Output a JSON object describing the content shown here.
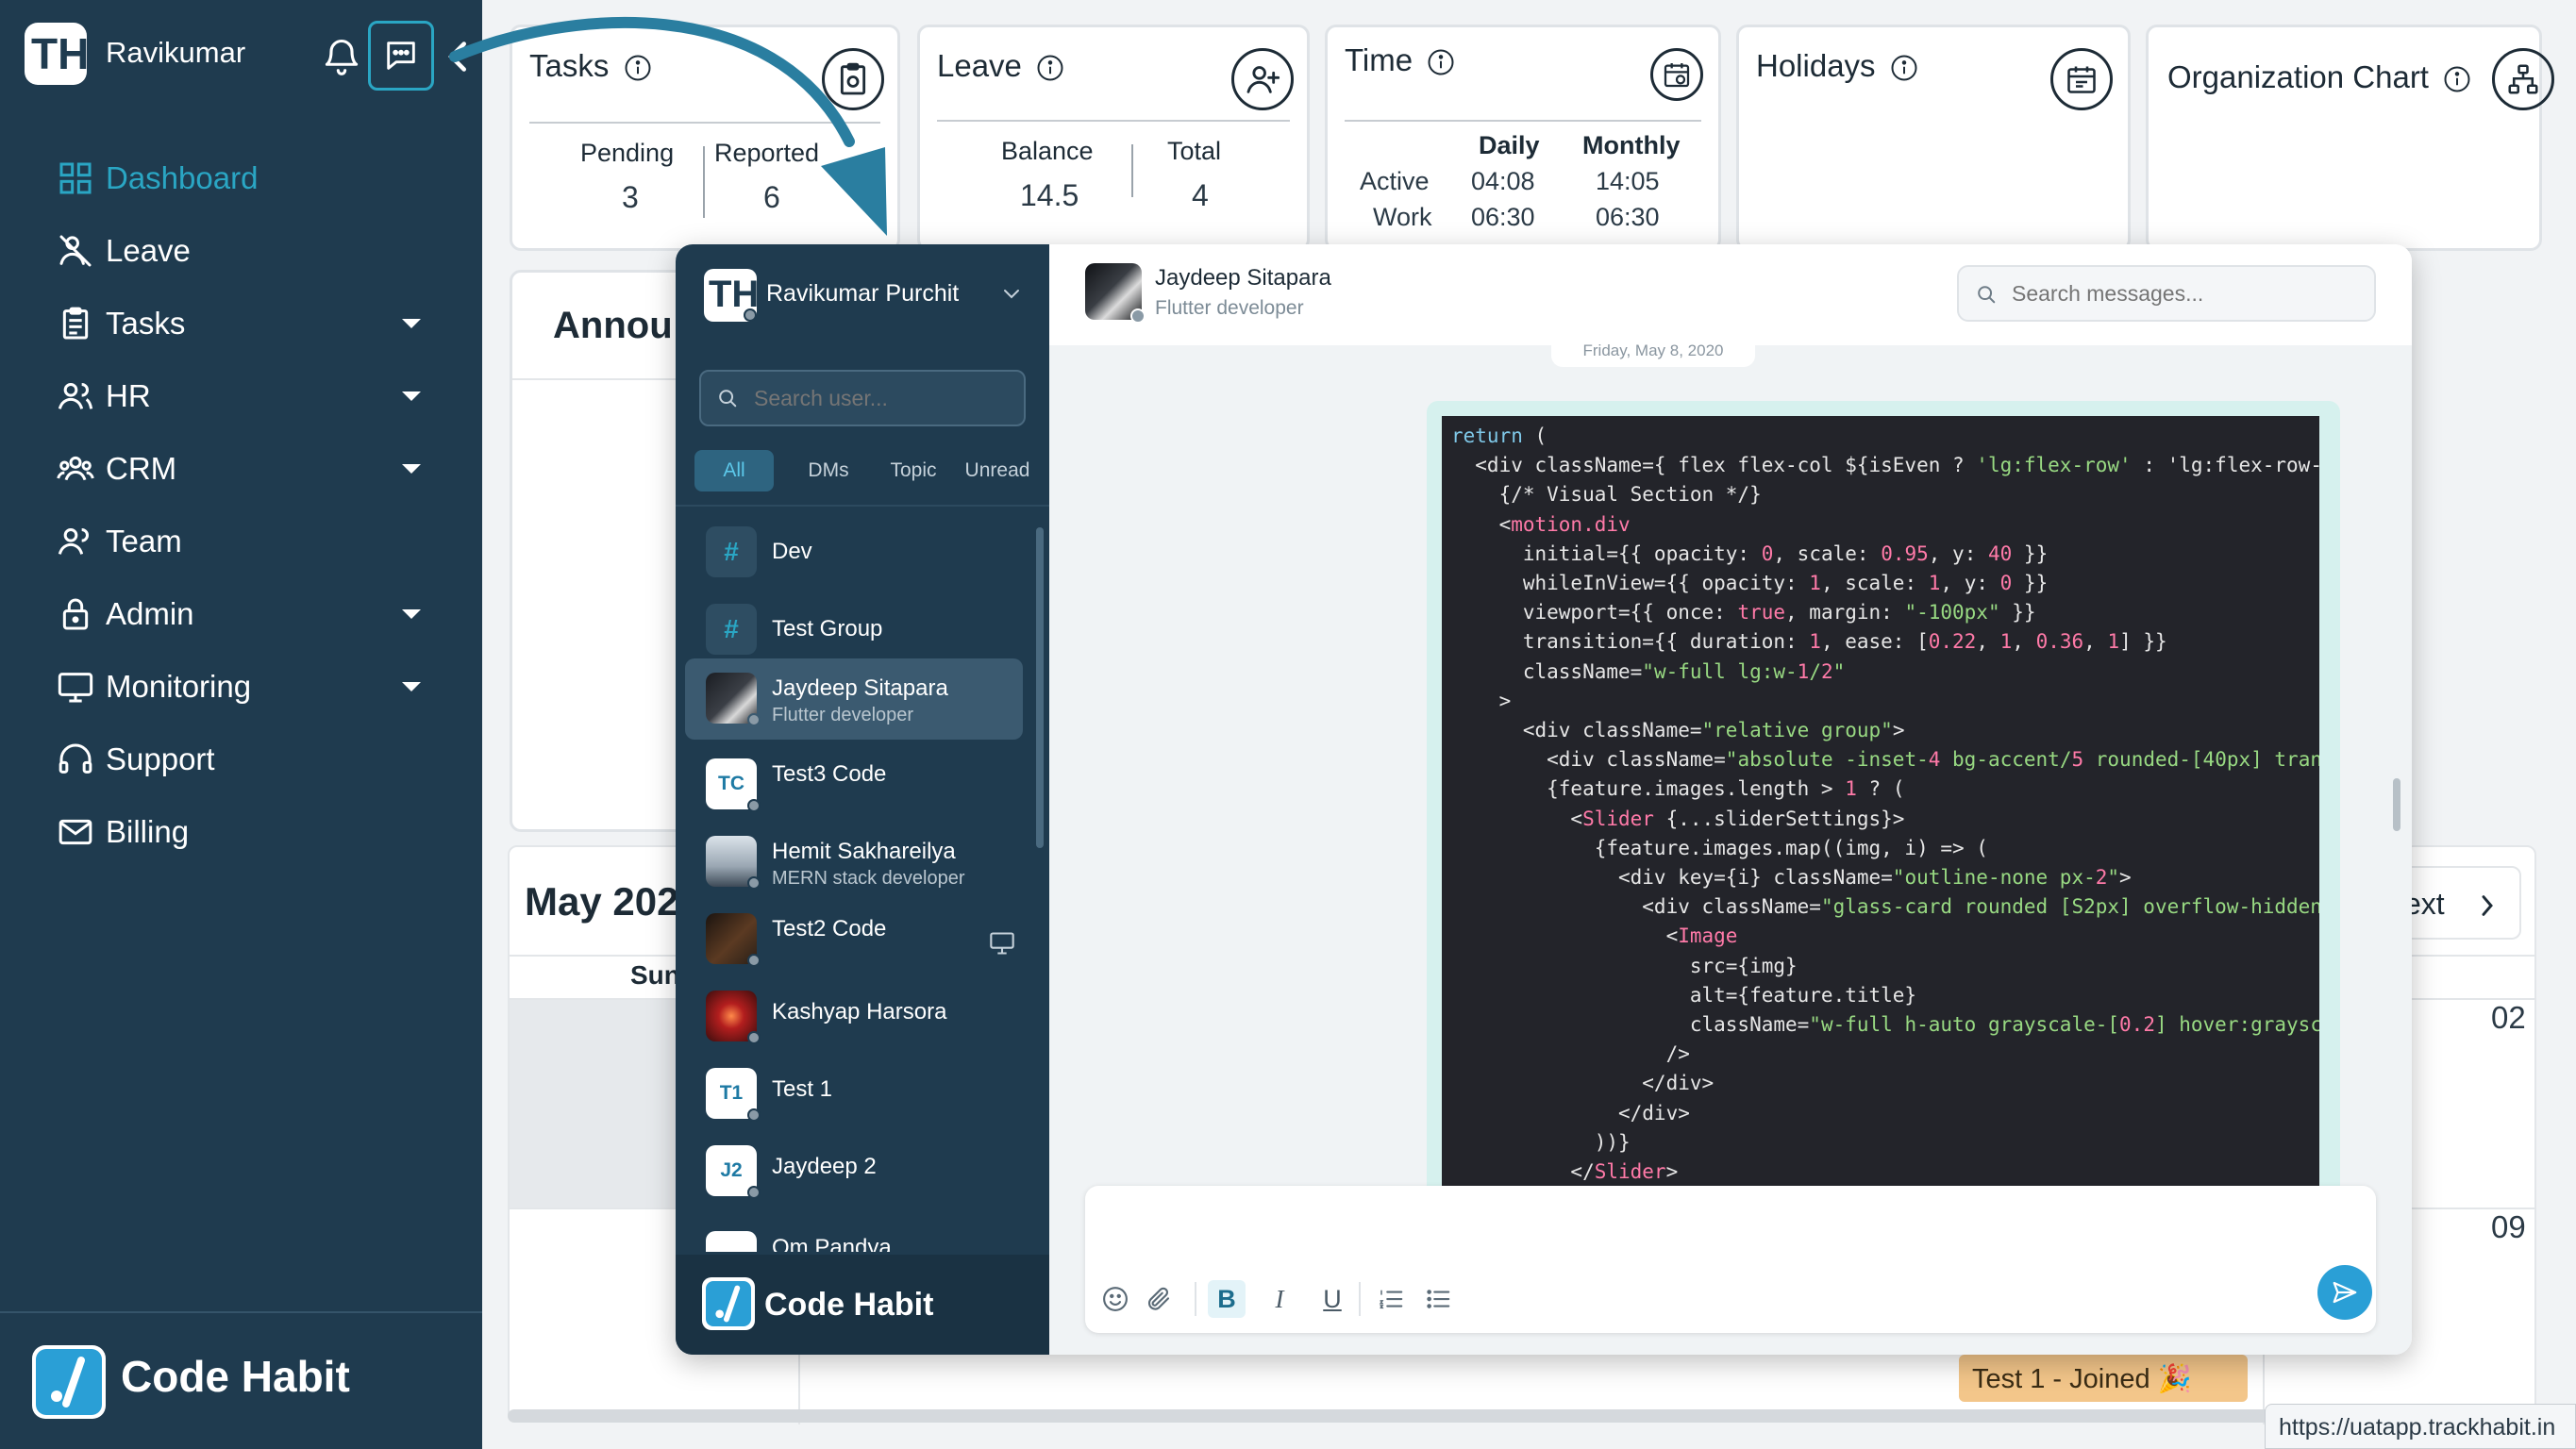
{
  "sidebar": {
    "logo_initials": "TH",
    "user_name": "Ravikumar",
    "nav": [
      {
        "label": "Dashboard",
        "icon": "dashboard-grid-icon",
        "active": true,
        "has_caret": false
      },
      {
        "label": "Leave",
        "icon": "leave-icon",
        "has_caret": false
      },
      {
        "label": "Tasks",
        "icon": "clipboard-icon",
        "has_caret": true
      },
      {
        "label": "HR",
        "icon": "hr-users-icon",
        "has_caret": true
      },
      {
        "label": "CRM",
        "icon": "crm-group-icon",
        "has_caret": true
      },
      {
        "label": "Team",
        "icon": "team-users-icon",
        "has_caret": false
      },
      {
        "label": "Admin",
        "icon": "lock-icon",
        "has_caret": true
      },
      {
        "label": "Monitoring",
        "icon": "monitor-icon",
        "has_caret": true
      },
      {
        "label": "Support",
        "icon": "headset-icon",
        "has_caret": false
      },
      {
        "label": "Billing",
        "icon": "mail-icon",
        "has_caret": false
      }
    ],
    "brand": "Code Habit"
  },
  "cards": {
    "tasks": {
      "title": "Tasks",
      "pending_label": "Pending",
      "pending_value": "3",
      "reported_label": "Reported",
      "reported_value": "6"
    },
    "leave": {
      "title": "Leave",
      "balance_label": "Balance",
      "balance_value": "14.5",
      "total_label": "Total",
      "total_value": "4"
    },
    "time": {
      "title": "Time",
      "daily_label": "Daily",
      "monthly_label": "Monthly",
      "active_label": "Active",
      "work_label": "Work",
      "active_daily": "04:08",
      "active_monthly": "14:05",
      "work_daily": "06:30",
      "work_monthly": "06:30"
    },
    "holidays": {
      "title": "Holidays"
    },
    "org": {
      "title": "Organization Chart"
    }
  },
  "dashboard": {
    "announcements_title": "Annou",
    "calendar_month": "May 202",
    "calendar_weekday": "Sun",
    "calendar_next": "ext",
    "day_02": "02",
    "day_09": "09",
    "event_label": "Test 1 - Joined 🎉",
    "status_url": "https://uatapp.trackhabit.in"
  },
  "chat": {
    "current_user": "Ravikumar Purchit",
    "search_user_placeholder": "Search user...",
    "filters": [
      "All",
      "DMs",
      "Topic",
      "Unread"
    ],
    "conversations": [
      {
        "name": "Dev",
        "type": "channel"
      },
      {
        "name": "Test Group",
        "type": "channel"
      },
      {
        "name": "Jaydeep Sitapara",
        "subtitle": "Flutter developer",
        "type": "user",
        "selected": true
      },
      {
        "name": "Test3 Code",
        "initials": "TC",
        "type": "user"
      },
      {
        "name": "Hemit Sakhareilya",
        "subtitle": "MERN stack developer",
        "type": "user"
      },
      {
        "name": "Test2 Code",
        "type": "user",
        "has_monitor": true
      },
      {
        "name": "Kashyap Harsora",
        "type": "user"
      },
      {
        "name": "Test 1",
        "initials": "T1",
        "type": "user"
      },
      {
        "name": "Jaydeep 2",
        "initials": "J2",
        "type": "user"
      },
      {
        "name": "Om Pandya",
        "type": "user"
      }
    ],
    "brand": "Code Habit",
    "peer_name": "Jaydeep Sitapara",
    "peer_role": "Flutter developer",
    "search_messages_placeholder": "Search messages...",
    "date_chip": "Friday, May 8, 2020",
    "code_message": "return (\n  <div className={ flex flex-col ${isEven ? 'lg:flex-row' : 'lg:flex-row-rev\n    {/* Visual Section */}\n    <motion.div\n      initial={{ opacity: 0, scale: 0.95, y: 40 }}\n      whileInView={{ opacity: 1, scale: 1, y: 0 }}\n      viewport={{ once: true, margin: \"-100px\" }}\n      transition={{ duration: 1, ease: [0.22, 1, 0.36, 1] }}\n      className=\"w-full lg:w-1/2\"\n    >\n      <div className=\"relative group\">\n        <div className=\"absolute -inset-4 bg-accent/5 rounded-[40px] transit\n        {feature.images.length > 1 ? (\n          <Slider {...sliderSettings}>\n            {feature.images.map((img, i) => (\n              <div key={i} className=\"outline-none px-2\">\n                <div className=\"glass-card rounded [S2px] overflow-hidden\">\n                  <Image\n                    src={img}\n                    alt={feature.title}\n                    className=\"w-full h-auto grayscale-[0.2] hover:grayscale\n                  />\n                </div>\n              </div>\n            ))}\n          </Slider>"
  },
  "colors": {
    "sidebar_bg": "#1f3b4f",
    "accent": "#2aa6c4",
    "send_button": "#2a9fd6",
    "bubble_bg": "#d6f1ee",
    "code_bg": "#23242a"
  }
}
